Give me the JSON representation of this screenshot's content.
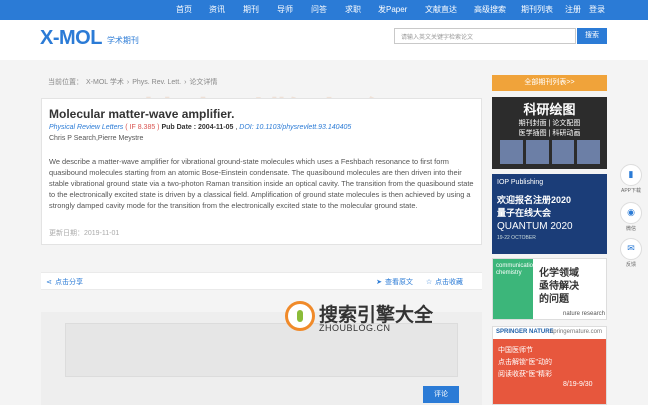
{
  "nav": {
    "items": [
      "首页",
      "资讯",
      "期刊",
      "导师",
      "问答",
      "求职",
      "发Paper",
      "文献直达",
      "高级搜索",
      "期刊列表",
      "注册",
      "登录"
    ]
  },
  "header": {
    "logo_text": "X-MOL",
    "logo_subtitle": "学术期刊",
    "search_placeholder": "请输入英文关键字检索论文",
    "search_button": "搜索"
  },
  "breadcrumb": {
    "prefix": "当前位置：",
    "items": [
      "X-MOL 学术",
      "›",
      "Phys. Rev. Lett.",
      "›",
      "论文详情"
    ]
  },
  "article": {
    "title": "Molecular matter-wave amplifier.",
    "journal": "Physical Review Letters",
    "if_label": "( IF 8.385 )",
    "pub_date": "Pub Date : 2004-11-05",
    "doi": "DOI: 10.1103/physrevlett.93.140405",
    "authors": "Chris P Search,Pierre Meystre",
    "abstract": "We describe a matter-wave amplifier for vibrational ground-state molecules which uses a Feshbach resonance to first form quasibound molecules starting from an atomic Bose-Einstein condensate. The quasibound molecules are then driven into their stable vibrational ground state via a two-photon Raman transition inside an optical cavity. The transition from the quasibound state to the electronically excited state is driven by a classical field. Amplification of ground state molecules is then achieved by using a strongly damped cavity mode for the transition from the electronically excited state to the molecular ground state.",
    "updated": "更新日期：2019-11-01"
  },
  "actions": {
    "share": "点击分享",
    "view_original": "查看原文",
    "favorite": "点击收藏"
  },
  "comment": {
    "placeholder": "",
    "submit": "评论"
  },
  "sidebar": {
    "header": "全部期刊列表>>",
    "ad1": {
      "title": "科研绘图",
      "line1": "期刊封面 | 论文配图",
      "line2": "医学插图 | 科研动画"
    },
    "ad2": {
      "publisher": "IOP Publishing",
      "line1": "欢迎报名注册2020",
      "line2": "量子在线大会",
      "line3": "QUANTUM 2020",
      "dates": "19-22 OCTOBER"
    },
    "ad3": {
      "brand": "communications chemistry",
      "line1": "化学领域",
      "line2": "亟待解决",
      "line3": "的问题",
      "foot": "nature research"
    },
    "ad4": {
      "brand": "SPRINGER NATURE",
      "site": "springernature.com",
      "line1": "中国医师节",
      "line2": "点击解锁\"医\"动的",
      "line3": "阅读收获\"医\"精彩",
      "date": "8/19-9/30"
    }
  },
  "float_tools": [
    {
      "icon": "app-icon",
      "glyph": "▮",
      "label": "APP下载"
    },
    {
      "icon": "wechat-icon",
      "glyph": "◉",
      "label": "微信"
    },
    {
      "icon": "feedback-icon",
      "glyph": "✉",
      "label": "反馈"
    }
  ],
  "watermark": {
    "text": "搜索引擎大全",
    "url": "ZHOUBLOG.CN"
  },
  "colors": {
    "primary": "#2b7bd6",
    "accent": "#f0a33a",
    "if_red": "#d9534f"
  }
}
